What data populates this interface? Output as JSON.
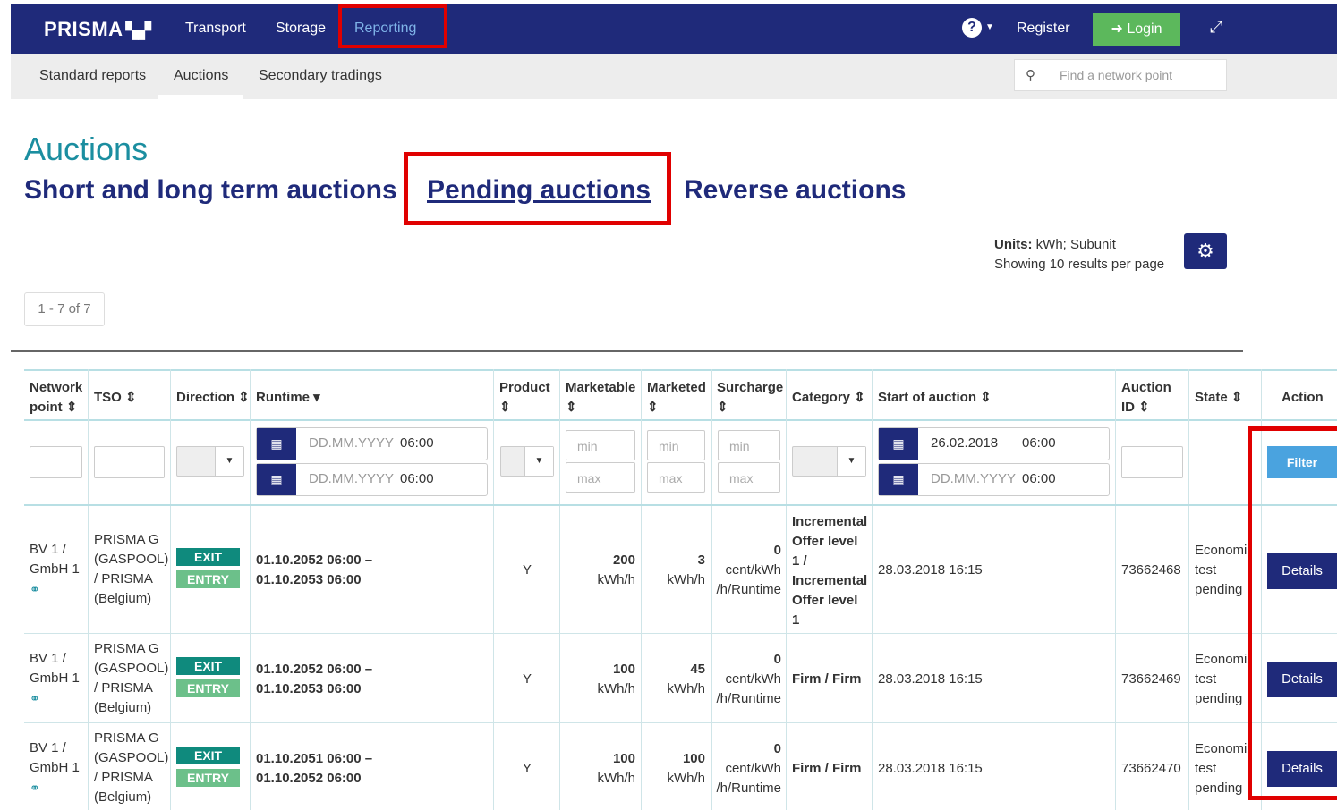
{
  "topnav": {
    "logo": "PRISMA",
    "items": [
      "Transport",
      "Storage",
      "Reporting"
    ],
    "active": "Reporting",
    "register": "Register",
    "login": "Login"
  },
  "subnav": {
    "items": [
      "Standard reports",
      "Auctions",
      "Secondary tradings"
    ],
    "active": "Auctions",
    "search_placeholder": "Find a network point"
  },
  "page": {
    "title": "Auctions",
    "tabs": [
      "Short and long term auctions",
      "Pending auctions",
      "Reverse auctions"
    ],
    "selected_tab": "Pending auctions",
    "units_label": "Units:",
    "units_value": " kWh; Subunit",
    "results_per_page": "Showing 10 results per page",
    "pager": "1 - 7 of 7"
  },
  "table": {
    "headers": [
      "Network point",
      "TSO",
      "Direction",
      "Runtime",
      "Product",
      "Marketable",
      "Marketed",
      "Surcharge",
      "Category",
      "Start of auction",
      "Auction ID",
      "State",
      "Action"
    ],
    "filters": {
      "date_placeholder": "DD.MM.YYYY",
      "time_default": "06:00",
      "start_from_date": "26.02.2018",
      "min": "min",
      "max": "max",
      "filter_button": "Filter"
    },
    "rows": [
      {
        "network_point": [
          "BV 1 /",
          "GmbH 1"
        ],
        "tso": [
          "PRISMA G",
          "(GASPOOL)",
          "/ PRISMA",
          "(Belgium)"
        ],
        "direction": [
          "EXIT",
          "ENTRY"
        ],
        "runtime": [
          "01.10.2052 06:00 –",
          "01.10.2053 06:00"
        ],
        "product": "Y",
        "marketable": [
          "200",
          "kWh/h"
        ],
        "marketed": [
          "3",
          "kWh/h"
        ],
        "surcharge": [
          "0",
          "cent/kWh",
          "/h/Runtime"
        ],
        "category": [
          "Incremental",
          "Offer level",
          "1 /",
          "Incremental",
          "Offer level",
          "1"
        ],
        "start": "28.03.2018 16:15",
        "auction_id": "73662468",
        "state": [
          "Economi",
          "test",
          "pending"
        ],
        "action": "Details"
      },
      {
        "network_point": [
          "BV 1 /",
          "GmbH 1"
        ],
        "tso": [
          "PRISMA G",
          "(GASPOOL)",
          "/ PRISMA",
          "(Belgium)"
        ],
        "direction": [
          "EXIT",
          "ENTRY"
        ],
        "runtime": [
          "01.10.2052 06:00 –",
          "01.10.2053 06:00"
        ],
        "product": "Y",
        "marketable": [
          "100",
          "kWh/h"
        ],
        "marketed": [
          "45",
          "kWh/h"
        ],
        "surcharge": [
          "0",
          "cent/kWh",
          "/h/Runtime"
        ],
        "category": [
          "Firm / Firm"
        ],
        "start": "28.03.2018 16:15",
        "auction_id": "73662469",
        "state": [
          "Economi",
          "test",
          "pending"
        ],
        "action": "Details"
      },
      {
        "network_point": [
          "BV 1 /",
          "GmbH 1"
        ],
        "tso": [
          "PRISMA G",
          "(GASPOOL)",
          "/ PRISMA",
          "(Belgium)"
        ],
        "direction": [
          "EXIT",
          "ENTRY"
        ],
        "runtime": [
          "01.10.2051 06:00 –",
          "01.10.2052 06:00"
        ],
        "product": "Y",
        "marketable": [
          "100",
          "kWh/h"
        ],
        "marketed": [
          "100",
          "kWh/h"
        ],
        "surcharge": [
          "0",
          "cent/kWh",
          "/h/Runtime"
        ],
        "category": [
          "Firm / Firm"
        ],
        "start": "28.03.2018 16:15",
        "auction_id": "73662470",
        "state": [
          "Economi",
          "test",
          "pending"
        ],
        "action": "Details"
      }
    ]
  },
  "colors": {
    "nav_bg": "#1f2a7a",
    "accent_teal": "#1b8ea0",
    "login_green": "#5cb85c",
    "filter_blue": "#4aa3df",
    "exit_badge": "#0f8a7d",
    "entry_badge": "#6cc08a",
    "highlight_red": "#e00000"
  },
  "icons": {
    "help": "question-circle-icon",
    "login": "sign-in-icon",
    "expand": "expand-icon",
    "search": "search-icon",
    "settings": "gear-icon",
    "calendar": "calendar-icon",
    "network_link": "link-icon"
  }
}
